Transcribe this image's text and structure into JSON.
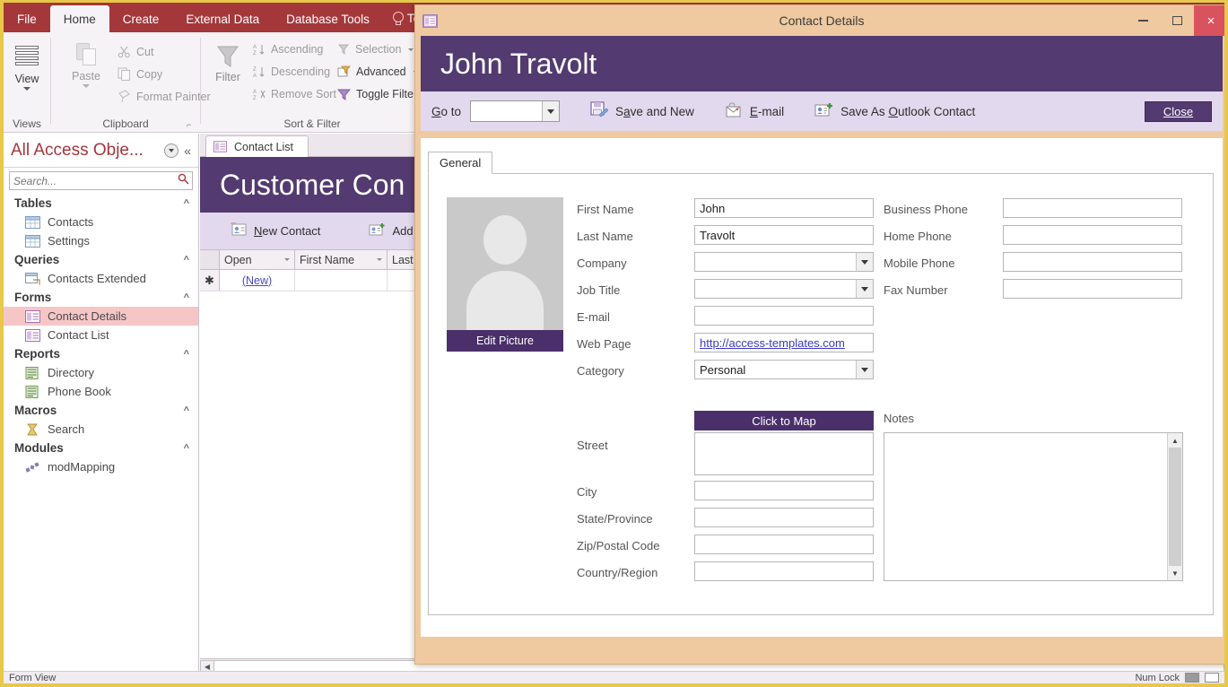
{
  "ribbon": {
    "tabs": [
      {
        "label": "File",
        "active": false
      },
      {
        "label": "Home",
        "active": true
      },
      {
        "label": "Create",
        "active": false
      },
      {
        "label": "External Data",
        "active": false
      },
      {
        "label": "Database Tools",
        "active": false
      }
    ],
    "tell_me": "Te",
    "groups": [
      {
        "label": "Views"
      },
      {
        "label": "Clipboard"
      },
      {
        "label": "Sort & Filter"
      }
    ],
    "views": {
      "label": "View"
    },
    "clipboard": {
      "paste": "Paste",
      "cut": "Cut",
      "copy": "Copy",
      "format_painter": "Format Painter"
    },
    "sortfilter": {
      "filter": "Filter",
      "ascending": "Ascending",
      "descending": "Descending",
      "remove_sort": "Remove Sort",
      "selection": "Selection",
      "advanced": "Advanced",
      "toggle_filter": "Toggle Filte"
    }
  },
  "navpane": {
    "title": "All Access Obje...",
    "collapse_label": "«",
    "search_placeholder": "Search...",
    "search_value": "",
    "groups": [
      {
        "label": "Tables",
        "items": [
          {
            "label": "Contacts",
            "selected": false
          },
          {
            "label": "Settings",
            "selected": false
          }
        ]
      },
      {
        "label": "Queries",
        "items": [
          {
            "label": "Contacts Extended",
            "selected": false
          }
        ]
      },
      {
        "label": "Forms",
        "items": [
          {
            "label": "Contact Details",
            "selected": true
          },
          {
            "label": "Contact List",
            "selected": false
          }
        ]
      },
      {
        "label": "Reports",
        "items": [
          {
            "label": "Directory",
            "selected": false
          },
          {
            "label": "Phone Book",
            "selected": false
          }
        ]
      },
      {
        "label": "Macros",
        "items": [
          {
            "label": "Search",
            "selected": false
          }
        ]
      },
      {
        "label": "Modules",
        "items": [
          {
            "label": "modMapping",
            "selected": false
          }
        ]
      }
    ]
  },
  "background_form": {
    "tab_label": "Contact List",
    "banner_title": "Customer Con",
    "toolbar": [
      {
        "label": "New Contact"
      },
      {
        "label": "Add"
      }
    ],
    "grid": {
      "columns": [
        "Open",
        "First Name",
        "Last"
      ],
      "rows": [
        {
          "open": "(New)",
          "first_name": "",
          "last_name": ""
        }
      ]
    }
  },
  "dialog": {
    "title": "Contact Details",
    "banner_title": "John Travolt",
    "window_controls": {
      "minimize": "minimize-icon",
      "maximize": "maximize-icon",
      "close": "×"
    },
    "toolbar": {
      "goto_label": "Go to",
      "goto_value": "",
      "save_and_new": "Save and New",
      "email": "E-mail",
      "save_as_outlook": "Save As Outlook Contact",
      "close_label": "Close"
    },
    "tabs": [
      {
        "label": "General",
        "active": true
      }
    ],
    "edit_picture_label": "Edit Picture",
    "click_to_map_label": "Click to Map",
    "notes_label": "Notes",
    "notes_value": "",
    "fields_left": [
      {
        "label": "First Name",
        "value": "John",
        "type": "text"
      },
      {
        "label": "Last Name",
        "value": "Travolt",
        "type": "text"
      },
      {
        "label": "Company",
        "value": "",
        "type": "combo"
      },
      {
        "label": "Job Title",
        "value": "",
        "type": "combo"
      },
      {
        "label": "E-mail",
        "value": "",
        "type": "text"
      },
      {
        "label": "Web Page",
        "value": "http://access-templates.com",
        "type": "link"
      },
      {
        "label": "Category",
        "value": "Personal",
        "type": "combo"
      }
    ],
    "fields_right": [
      {
        "label": "Business Phone",
        "value": "",
        "type": "text"
      },
      {
        "label": "Home Phone",
        "value": "",
        "type": "text"
      },
      {
        "label": "Mobile Phone",
        "value": "",
        "type": "text"
      },
      {
        "label": "Fax Number",
        "value": "",
        "type": "text"
      }
    ],
    "fields_address": [
      {
        "label": "Street",
        "value": "",
        "type": "textarea"
      },
      {
        "label": "City",
        "value": "",
        "type": "text"
      },
      {
        "label": "State/Province",
        "value": "",
        "type": "text"
      },
      {
        "label": "Zip/Postal Code",
        "value": "",
        "type": "text"
      },
      {
        "label": "Country/Region",
        "value": "",
        "type": "text"
      }
    ]
  },
  "statusbar": {
    "view_mode": "Form View",
    "num_lock": "Num Lock"
  },
  "colors": {
    "ribbon_red": "#A4373A",
    "form_purple": "#533A70",
    "toolbar_lavender": "#E3D9EE",
    "window_border_yellow": "#E8C84A",
    "dialog_peach": "#EFC9A0",
    "selected_pink": "#F6C6C6",
    "link_blue": "#3A3AC8"
  }
}
